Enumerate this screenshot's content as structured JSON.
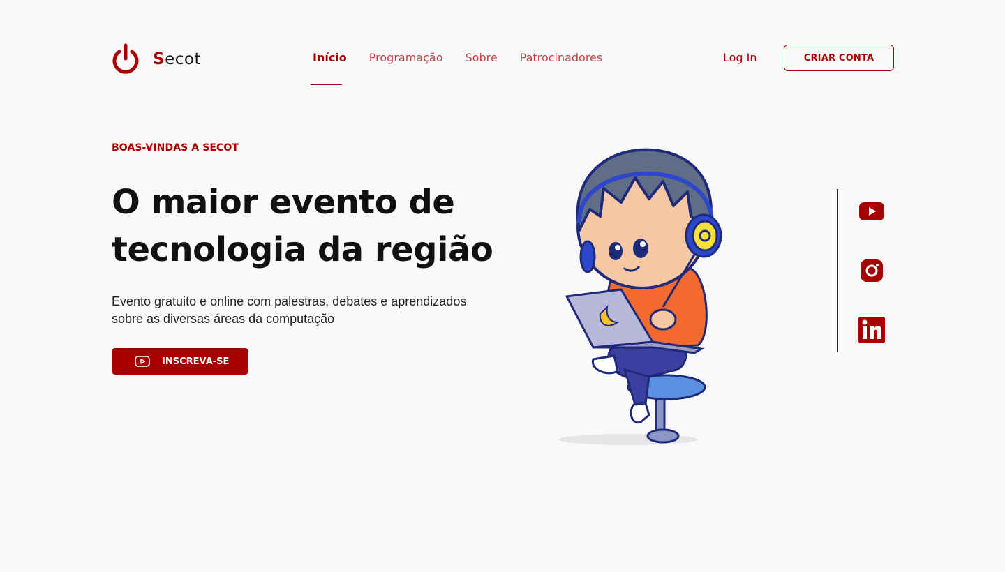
{
  "brand": {
    "initial": "S",
    "rest": "ecot",
    "color": "#a80000"
  },
  "nav": {
    "items": [
      {
        "label": "Início",
        "active": true
      },
      {
        "label": "Programação",
        "active": false
      },
      {
        "label": "Sobre",
        "active": false
      },
      {
        "label": "Patrocinadores",
        "active": false
      }
    ],
    "login_label": "Log In",
    "signup_label": "CRIAR CONTA"
  },
  "hero": {
    "eyebrow": "BOAS-VINDAS A SECOT",
    "title": "O maior evento de tecnologia da região",
    "description": "Evento gratuito e online com palestras, debates e aprendizados sobre as diversas áreas da computação",
    "cta_label": "INSCREVA-SE",
    "cta_icon": "youtube-icon",
    "illustration": "boy-with-headphones-and-laptop"
  },
  "social": [
    {
      "name": "youtube",
      "icon": "youtube-icon"
    },
    {
      "name": "instagram",
      "icon": "instagram-icon"
    },
    {
      "name": "linkedin",
      "icon": "linkedin-icon"
    }
  ],
  "colors": {
    "accent": "#a80000",
    "nav_inactive": "#c0444a",
    "background": "#f9f9f9"
  }
}
